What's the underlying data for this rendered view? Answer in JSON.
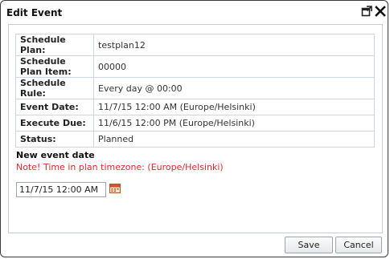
{
  "dialog": {
    "title": "Edit Event",
    "popout_icon": "popout-icon",
    "close_icon": "close-icon"
  },
  "details": [
    {
      "label": "Schedule Plan:",
      "value": "testplan12"
    },
    {
      "label": "Schedule Plan Item:",
      "value": "00000"
    },
    {
      "label": "Schedule Rule:",
      "value": "Every day @ 00:00"
    },
    {
      "label": "Event Date:",
      "value": "11/7/15 12:00 AM (Europe/Helsinki)"
    },
    {
      "label": "Execute Due:",
      "value": "11/6/15 12:00 PM (Europe/Helsinki)"
    },
    {
      "label": "Status:",
      "value": "Planned"
    }
  ],
  "new_event": {
    "heading": "New event date",
    "note": "Note! Time in plan timezone: (Europe/Helsinki)",
    "date_value": "11/7/15 12:00 AM",
    "calendar_icon": "calendar-icon"
  },
  "footer": {
    "save_label": "Save",
    "cancel_label": "Cancel"
  },
  "colors": {
    "note": "#e02b2b",
    "border": "#c5cfdc"
  }
}
